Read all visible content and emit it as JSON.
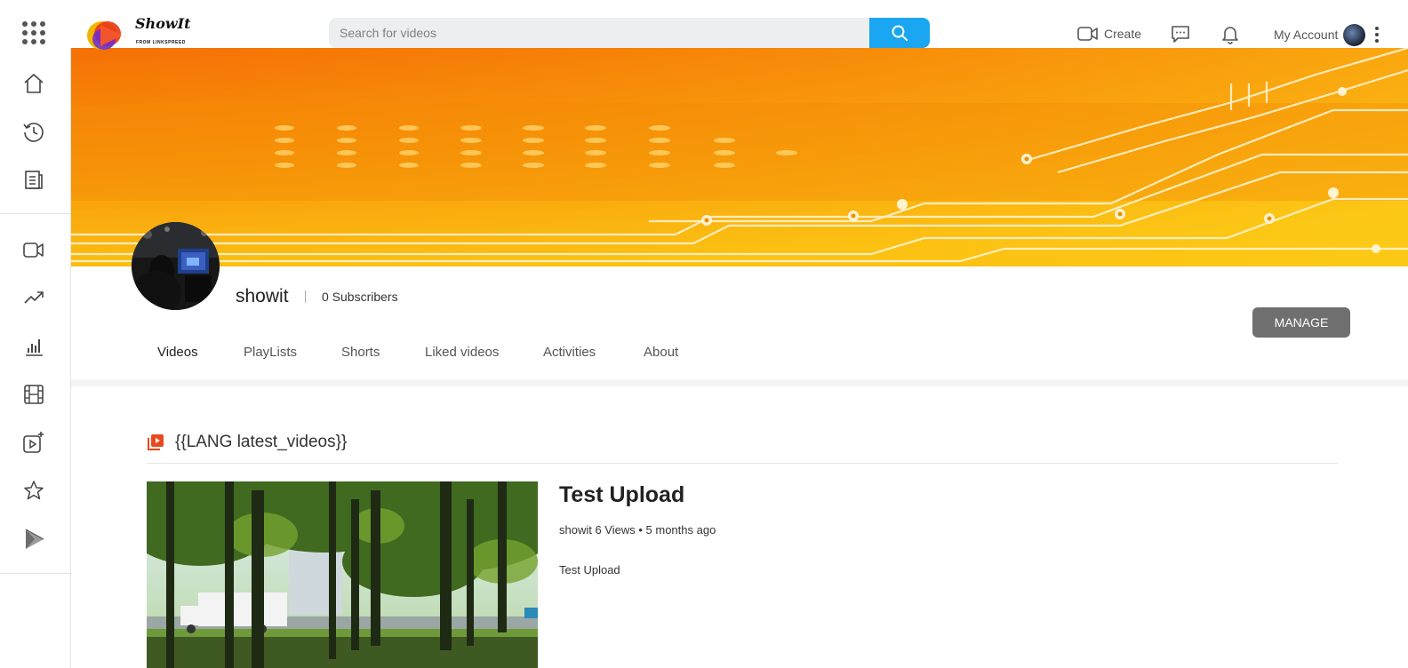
{
  "header": {
    "logo": {
      "word": "ShowIt",
      "sub": "FROM LINKSPREED"
    },
    "search": {
      "placeholder": "Search for videos"
    },
    "create_label": "Create",
    "account_label": "My Account"
  },
  "sidebar": {
    "items": [
      {
        "name": "home",
        "icon": "home-icon"
      },
      {
        "name": "history",
        "icon": "history-icon"
      },
      {
        "name": "articles",
        "icon": "article-icon"
      },
      {
        "name": "videos",
        "icon": "video-camera-icon"
      },
      {
        "name": "trending",
        "icon": "trending-icon"
      },
      {
        "name": "stats",
        "icon": "bar-chart-icon"
      },
      {
        "name": "movies",
        "icon": "film-icon"
      },
      {
        "name": "add-video",
        "icon": "add-video-icon"
      },
      {
        "name": "favorites",
        "icon": "star-icon"
      },
      {
        "name": "play-store",
        "icon": "play-store-icon"
      }
    ]
  },
  "channel": {
    "name": "showit",
    "subscribers": "0 Subscribers",
    "manage_label": "MANAGE"
  },
  "tabs": [
    "Videos",
    "PlayLists",
    "Shorts",
    "Liked videos",
    "Activities",
    "About"
  ],
  "active_tab": "Videos",
  "section": {
    "title": "{{LANG latest_videos}}"
  },
  "video": {
    "title": "Test Upload",
    "meta": "showit 6 Views • 5 months ago",
    "description": "Test Upload"
  },
  "colors": {
    "accent": "#1aa6f0",
    "manage_bg": "#6f6f6f",
    "section_icon": "#e8491f",
    "banner_orange": "#f57a05",
    "banner_yellow": "#fcc20f"
  }
}
